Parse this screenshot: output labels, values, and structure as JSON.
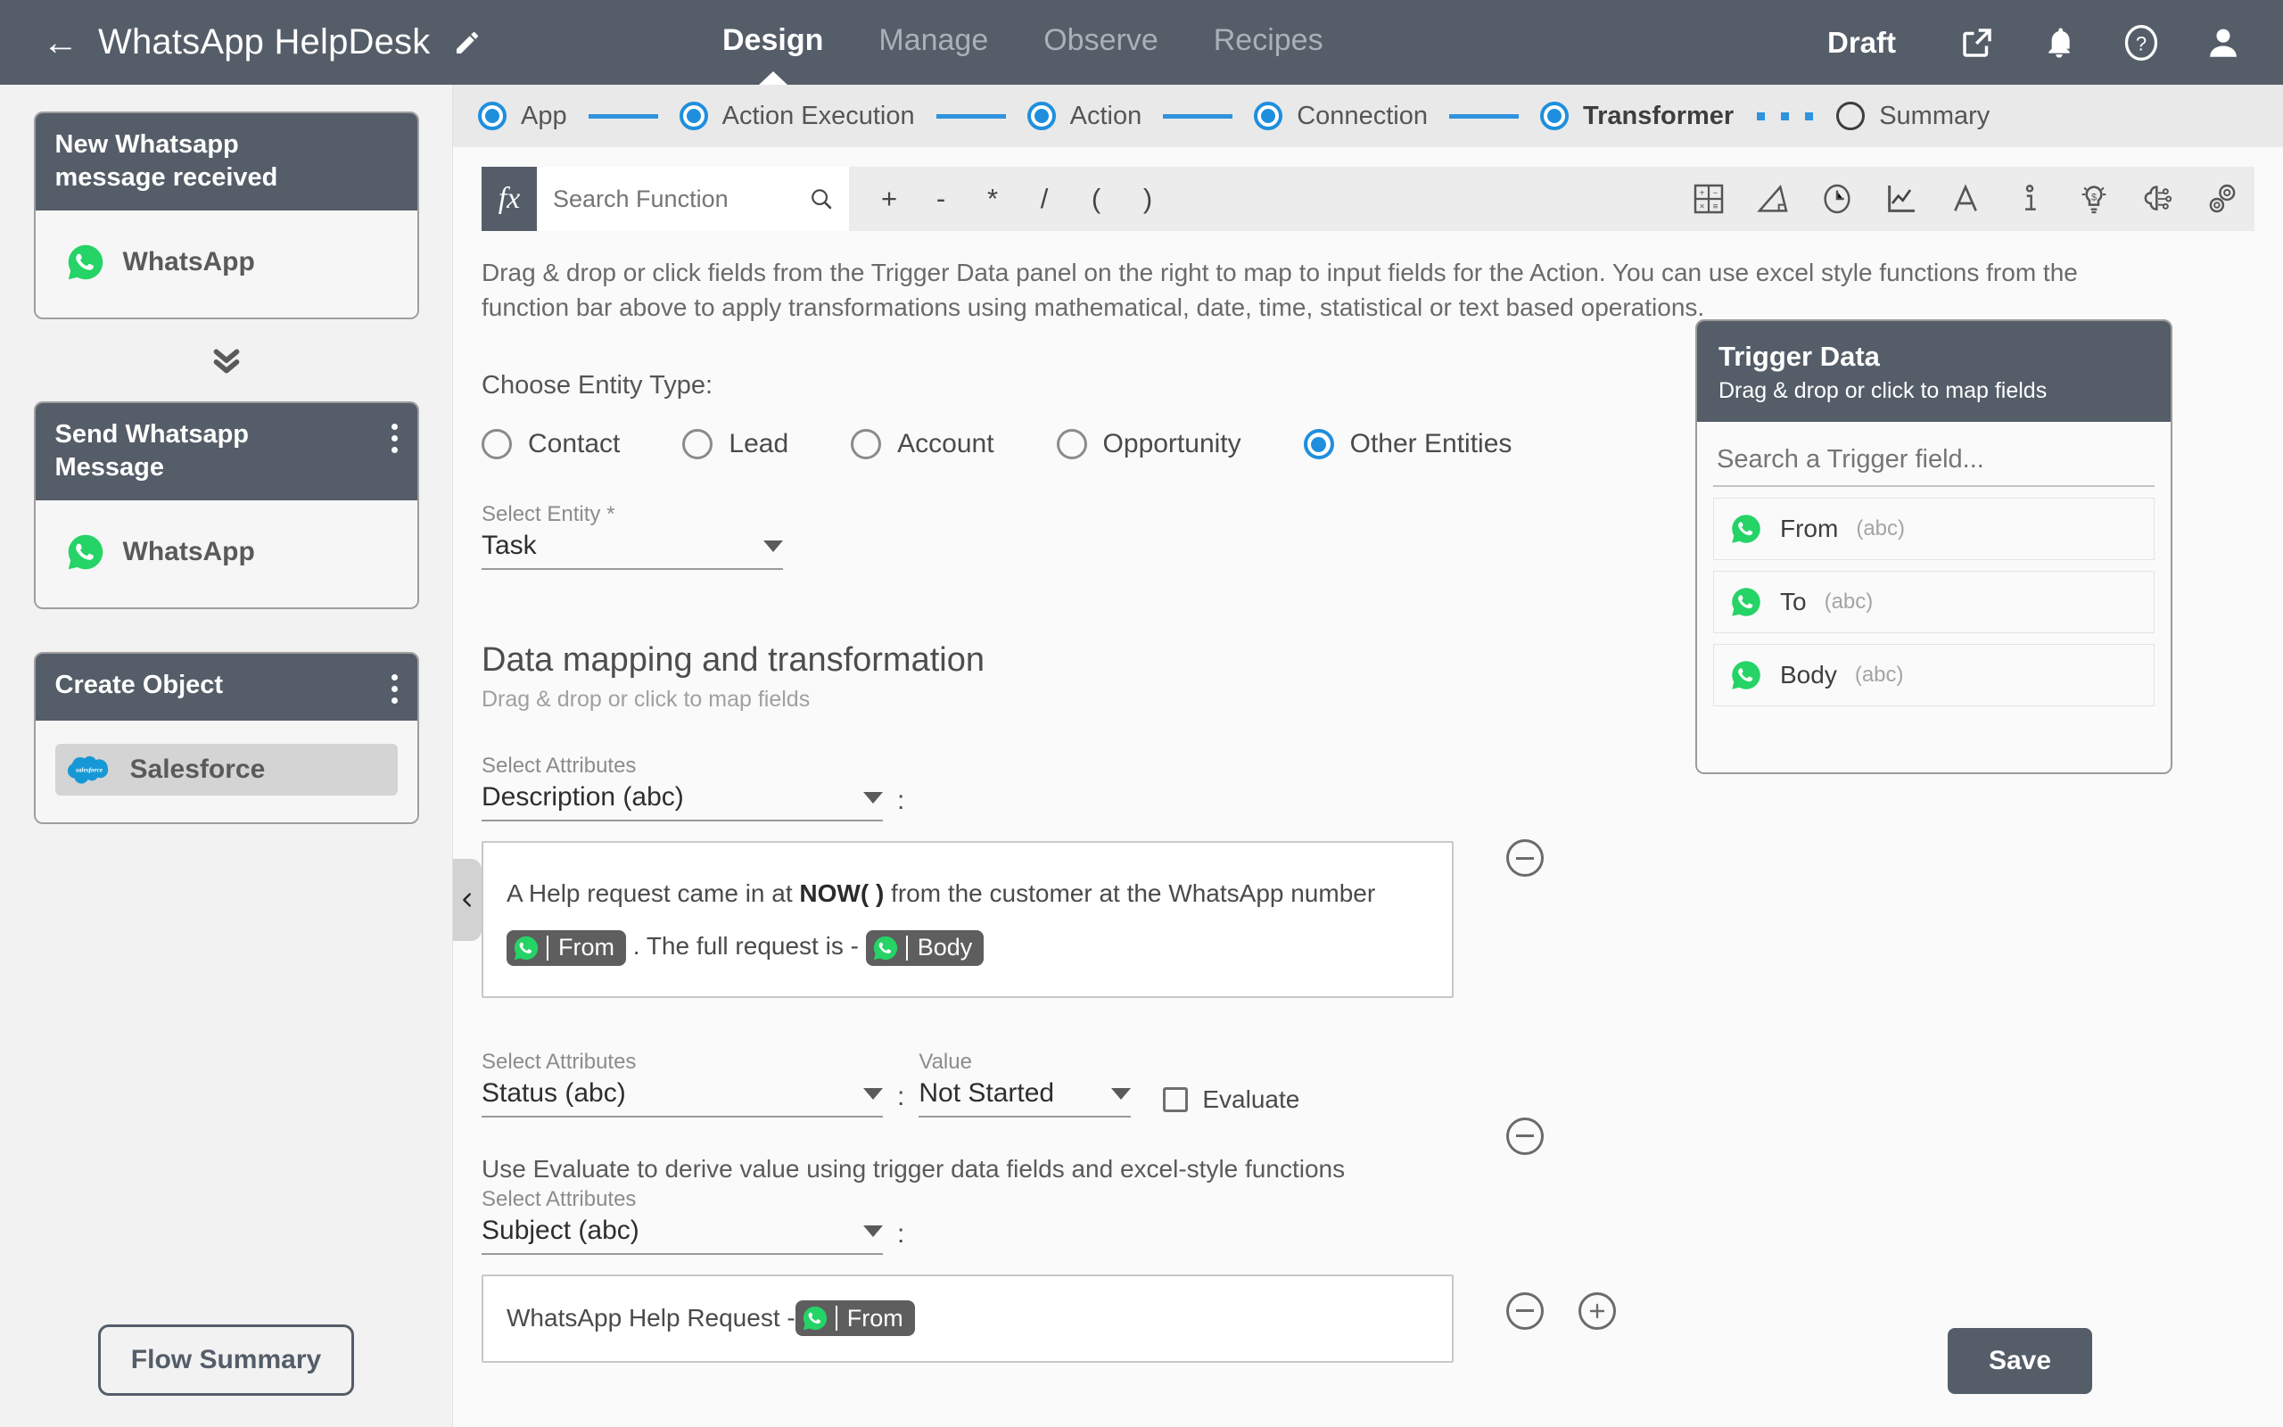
{
  "header": {
    "back_icon": "back-arrow-icon",
    "title": "WhatsApp HelpDesk",
    "edit_icon": "pencil-icon",
    "tabs": [
      {
        "label": "Design",
        "active": true
      },
      {
        "label": "Manage",
        "active": false
      },
      {
        "label": "Observe",
        "active": false
      },
      {
        "label": "Recipes",
        "active": false
      }
    ],
    "status": "Draft",
    "icons": [
      "external-link-icon",
      "bell-icon",
      "help-icon",
      "user-avatar-icon"
    ],
    "bar_color": "#545d68"
  },
  "sidebar": {
    "nodes": [
      {
        "title": "New Whatsapp message received",
        "app": "WhatsApp",
        "app_icon": "whatsapp-icon",
        "has_menu": false,
        "selected": false
      },
      {
        "title": "Send Whatsapp Message",
        "app": "WhatsApp",
        "app_icon": "whatsapp-icon",
        "has_menu": true,
        "selected": false
      },
      {
        "title": "Create Object",
        "app": "Salesforce",
        "app_icon": "salesforce-icon",
        "has_menu": true,
        "selected": true
      }
    ],
    "connector_icon": "double-chevron-down-icon",
    "flow_summary_label": "Flow Summary",
    "collapse_icon": "chevron-left-icon"
  },
  "stepper": {
    "steps": [
      {
        "label": "App",
        "state": "done"
      },
      {
        "label": "Action Execution",
        "state": "done"
      },
      {
        "label": "Action",
        "state": "done"
      },
      {
        "label": "Connection",
        "state": "done"
      },
      {
        "label": "Transformer",
        "state": "current"
      },
      {
        "label": "Summary",
        "state": "todo"
      }
    ],
    "accent_color": "#1f8fdd"
  },
  "function_bar": {
    "fx_label": "fx",
    "search_placeholder": "Search Function",
    "search_value": "",
    "search_icon": "search-icon",
    "operators": [
      "+",
      "-",
      "*",
      "/",
      "(",
      ")"
    ],
    "category_icons": [
      "calculator-icon",
      "trigonometry-icon",
      "clock-icon",
      "statistics-chart-icon",
      "text-a-icon",
      "info-icon",
      "financial-bulb-icon",
      "ai-brain-icon",
      "settings-gears-icon"
    ]
  },
  "main": {
    "intro": "Drag & drop or click fields from the Trigger Data panel on the right to map to input fields for the Action. You can use excel style functions from the function bar above to apply transformations using mathematical, date, time, statistical or text based operations.",
    "entity_type_label": "Choose Entity Type:",
    "entity_types": [
      {
        "label": "Contact",
        "selected": false
      },
      {
        "label": "Lead",
        "selected": false
      },
      {
        "label": "Account",
        "selected": false
      },
      {
        "label": "Opportunity",
        "selected": false
      },
      {
        "label": "Other Entities",
        "selected": true
      }
    ],
    "select_entity_label": "Select Entity *",
    "select_entity_value": "Task",
    "mapping_title": "Data mapping and transformation",
    "mapping_subtitle": "Drag & drop or click to map fields",
    "attributes_label": "Select Attributes",
    "value_label": "Value",
    "evaluate_label": "Evaluate",
    "evaluate_checked": false,
    "evaluate_hint": "Use Evaluate to derive value using trigger data fields and excel-style functions",
    "rows": [
      {
        "attribute": "Description (abc)",
        "expression_parts": [
          {
            "type": "text",
            "text": "A Help request came in at "
          },
          {
            "type": "function",
            "text": "NOW( )"
          },
          {
            "type": "text",
            "text": " from the customer at the WhatsApp number "
          },
          {
            "type": "chip",
            "text": "From",
            "icon": "whatsapp-icon"
          },
          {
            "type": "text",
            "text": " . The full request is - "
          },
          {
            "type": "chip",
            "text": "Body",
            "icon": "whatsapp-icon"
          }
        ]
      },
      {
        "attribute": "Status (abc)",
        "value": "Not Started"
      },
      {
        "attribute": "Subject (abc)",
        "expression_parts": [
          {
            "type": "text",
            "text": "WhatsApp Help Request - "
          },
          {
            "type": "chip",
            "text": "From",
            "icon": "whatsapp-icon"
          }
        ]
      }
    ],
    "remove_icon": "minus-circle-icon",
    "add_icon": "plus-circle-icon",
    "save_label": "Save"
  },
  "trigger_panel": {
    "title": "Trigger Data",
    "subtitle": "Drag & drop or click to map fields",
    "search_placeholder": "Search a Trigger field...",
    "search_value": "",
    "fields": [
      {
        "name": "From",
        "type": "(abc)",
        "icon": "whatsapp-icon"
      },
      {
        "name": "To",
        "type": "(abc)",
        "icon": "whatsapp-icon"
      },
      {
        "name": "Body",
        "type": "(abc)",
        "icon": "whatsapp-icon"
      }
    ]
  }
}
